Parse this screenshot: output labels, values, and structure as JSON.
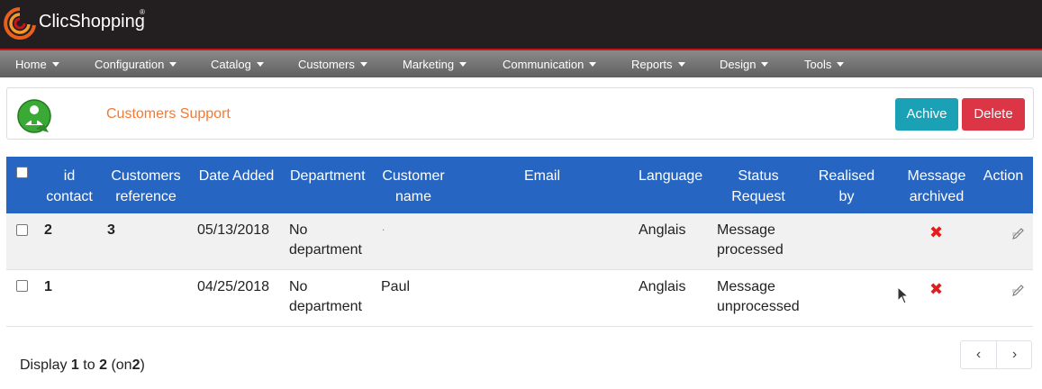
{
  "app": {
    "brand": "ClicShopping",
    "reg_mark": "®"
  },
  "menu": [
    {
      "label": "Home"
    },
    {
      "label": "Configuration"
    },
    {
      "label": "Catalog"
    },
    {
      "label": "Customers"
    },
    {
      "label": "Marketing"
    },
    {
      "label": "Communication"
    },
    {
      "label": "Reports"
    },
    {
      "label": "Design"
    },
    {
      "label": "Tools"
    }
  ],
  "panel": {
    "title": "Customers Support",
    "archive_label": "Achive",
    "delete_label": "Delete"
  },
  "table": {
    "headers": {
      "id": [
        "id",
        "contact"
      ],
      "ref": [
        "Customers",
        "reference"
      ],
      "date": "Date Added",
      "department": "Department",
      "name": [
        "Customer",
        "name"
      ],
      "email": "Email",
      "language": "Language",
      "status": [
        "Status",
        "Request"
      ],
      "realised": [
        "Realised",
        "by"
      ],
      "archived": [
        "Message",
        "archived"
      ],
      "action": "Action"
    },
    "rows": [
      {
        "id": "2",
        "reference": "3",
        "date": "05/13/2018",
        "department": [
          "No",
          "department"
        ],
        "name": ".",
        "email": "",
        "language": "Anglais",
        "status": [
          "Message",
          "processed"
        ],
        "realised_by": "",
        "archived_icon": "red-x-icon",
        "action_icon": "edit-icon"
      },
      {
        "id": "1",
        "reference": "",
        "date": "04/25/2018",
        "department": [
          "No",
          "department"
        ],
        "name": "Paul",
        "email": "",
        "language": "Anglais",
        "status": [
          "Message",
          "unprocessed"
        ],
        "realised_by": "",
        "archived_icon": "red-x-icon",
        "action_icon": "edit-icon"
      }
    ]
  },
  "footer": {
    "display": "Display",
    "from": "1",
    "to_word": "to",
    "to": "2",
    "on_open": "(on",
    "total": "2",
    "on_close": ")"
  },
  "pager": {
    "prev": "‹",
    "next": "›"
  },
  "colors": {
    "topbar": "#231f20",
    "accent_red": "#c8141b",
    "header_blue": "#2665c2",
    "title_orange": "#f07b37",
    "archive_btn": "#1ba1b6",
    "delete_btn": "#dc3545"
  }
}
